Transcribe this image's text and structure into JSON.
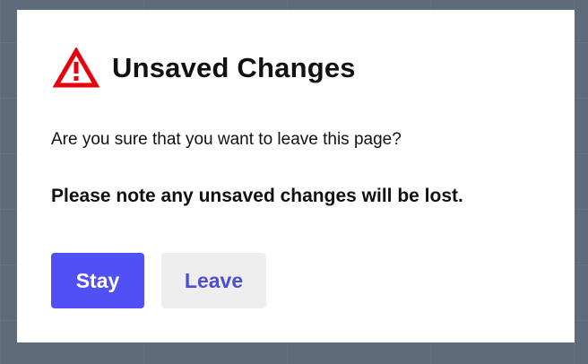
{
  "dialog": {
    "icon": "warning-triangle-icon",
    "title": "Unsaved Changes",
    "message": "Are you sure that you want to leave this page?",
    "warning": "Please note any unsaved changes will be lost.",
    "buttons": {
      "stay_label": "Stay",
      "leave_label": "Leave"
    }
  },
  "colors": {
    "overlay": "#5f6b7a",
    "dialog_background": "#ffffff",
    "warning_icon": "#e8000b",
    "primary_button": "#5050f5",
    "primary_button_text": "#ffffff",
    "secondary_button": "#eeeeee",
    "secondary_button_text": "#4b4fd6"
  }
}
